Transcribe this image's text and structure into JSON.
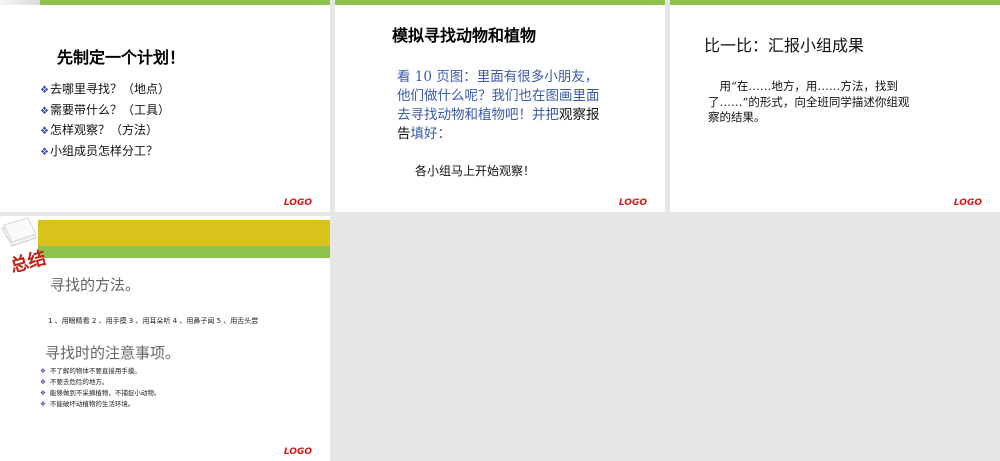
{
  "slides": [
    {
      "title": "先制定一个计划！",
      "items": [
        "去哪里寻找？（地点）",
        "需要带什么？（工具）",
        "怎样观察？（方法）",
        "小组成员怎样分工？"
      ],
      "logo": "LOGO"
    },
    {
      "title": "模拟寻找动物和植物",
      "para_blue": "看 10 页图：里面有很多小朋友，他们做什么呢？我们也在图画里面去寻找动物和植物吧！并把",
      "para_dark": "观察报告",
      "para_end": "填好：",
      "sub": "各小组马上开始观察！",
      "logo": "LOGO"
    },
    {
      "title": "比一比：汇报小组成果",
      "para": "用“在……地方，用……方法，找到了……”的形式，向全班同学描述你组观察的结果。",
      "logo": "LOGO"
    },
    {
      "badge": "总结",
      "heading1": "寻找的方法。",
      "methods": "1 、用眼睛看  2 、用手摸   3 、用耳朵听  4 、用鼻子闻 5 、用舌头尝",
      "heading2": "寻找时的注意事项。",
      "items": [
        "不了解的物体不要直接用手摸。",
        "不要去危险的地方。",
        "能够做到不采摘植物，不捕捉小动物。",
        "不能破坏动植物的生活环境。"
      ],
      "logo": "LOGO"
    }
  ],
  "colors": {
    "green": "#8dc34d",
    "yellow": "#d9c21b",
    "logo_red": "#d11a1a",
    "bullet_blue": "#3b49b3"
  }
}
